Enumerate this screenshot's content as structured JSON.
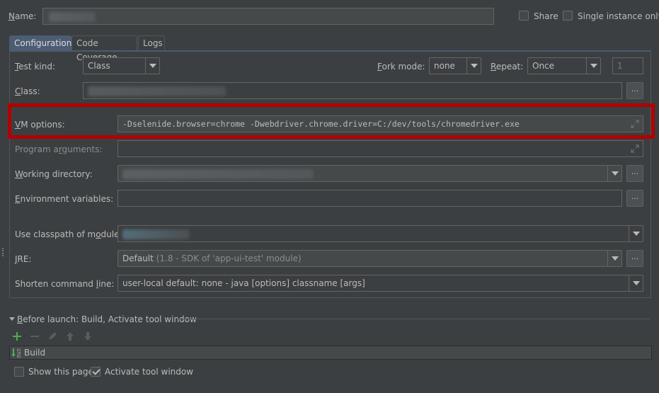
{
  "header": {
    "name_label": "Name:",
    "name_value": "",
    "share_label": "Share",
    "share_checked": false,
    "single_instance_label": "Single instance only",
    "single_instance_checked": false
  },
  "tabs": [
    {
      "label": "Configuration",
      "active": true
    },
    {
      "label": "Code Coverage",
      "active": false
    },
    {
      "label": "Logs",
      "active": false
    }
  ],
  "config": {
    "test_kind_label": "Test kind:",
    "test_kind_value": "Class",
    "fork_mode_label": "Fork mode:",
    "fork_mode_value": "none",
    "repeat_label": "Repeat:",
    "repeat_value": "Once",
    "repeat_count": "1",
    "class_label": "Class:",
    "class_value": "",
    "vm_options_label": "VM options:",
    "vm_options_value": "-Dselenide.browser=chrome -Dwebdriver.chrome.driver=C:/dev/tools/chromedriver.exe",
    "program_args_label": "Program arguments:",
    "program_args_value": "",
    "working_dir_label": "Working directory:",
    "working_dir_value": "",
    "env_vars_label": "Environment variables:",
    "env_vars_value": "",
    "classpath_label": "Use classpath of module:",
    "classpath_value": "",
    "jre_label": "JRE:",
    "jre_value_main": "Default",
    "jre_value_detail": "(1.8 - SDK of 'app-ui-test' module)",
    "shorten_label": "Shorten command line:",
    "shorten_value": "user-local default: none - java [options] classname [args]",
    "ellipsis": "..."
  },
  "before_launch": {
    "title": "Before launch: Build, Activate tool window",
    "toolbar": [
      "add",
      "remove",
      "edit",
      "move-up",
      "move-down"
    ],
    "items": [
      {
        "label": "Build"
      }
    ],
    "show_page_label": "Show this page",
    "show_page_checked": false,
    "activate_label": "Activate tool window",
    "activate_checked": true
  },
  "colors": {
    "background": "#3c3f41",
    "active_tab": "#4b5c73",
    "highlight_frame": "#b30000",
    "add_icon": "#4caf50"
  }
}
